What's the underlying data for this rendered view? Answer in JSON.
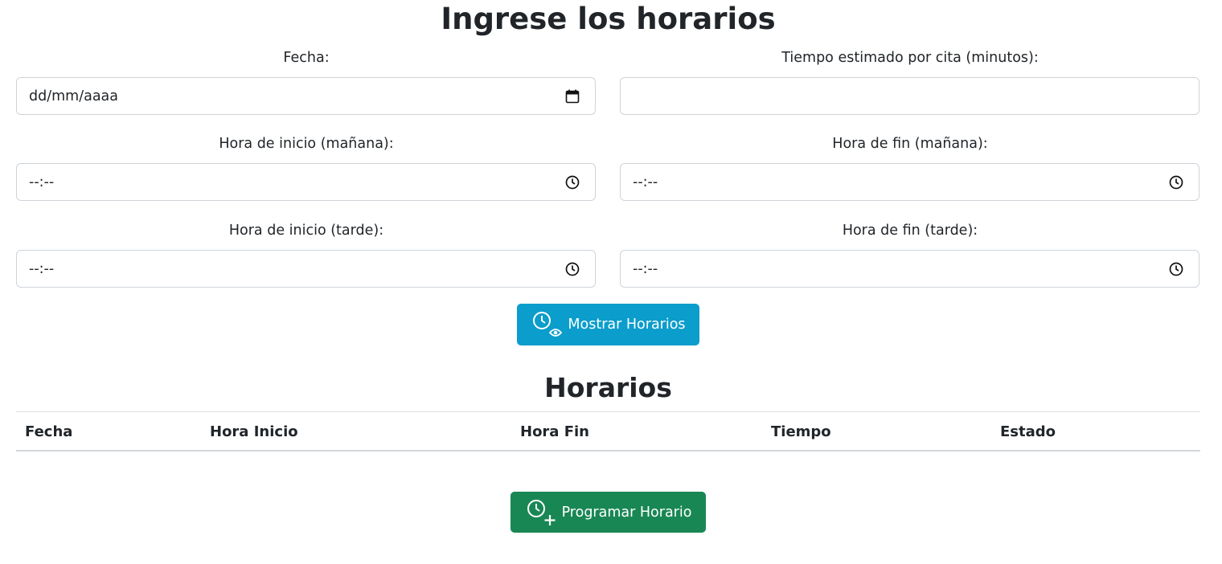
{
  "title": "Ingrese los horarios",
  "form": {
    "fecha": {
      "label": "Fecha:",
      "placeholder": "dd/mm/aaaa",
      "icon": "calendar-icon"
    },
    "tiempo": {
      "label": "Tiempo estimado por cita (minutos):",
      "value": ""
    },
    "inicio_manana": {
      "label": "Hora de inicio (mañana):",
      "placeholder": "--:--",
      "icon": "clock-icon"
    },
    "fin_manana": {
      "label": "Hora de fin (mañana):",
      "placeholder": "--:--",
      "icon": "clock-icon"
    },
    "inicio_tarde": {
      "label": "Hora de inicio (tarde):",
      "placeholder": "--:--",
      "icon": "clock-icon"
    },
    "fin_tarde": {
      "label": "Hora de fin (tarde):",
      "placeholder": "--:--",
      "icon": "clock-icon"
    }
  },
  "buttons": {
    "mostrar": {
      "label": "Mostrar Horarios",
      "icon": "clock-eye-icon",
      "color": "#0b9dcb"
    },
    "programar": {
      "label": "Programar Horario",
      "icon": "clock-plus-icon",
      "color": "#198754"
    }
  },
  "table": {
    "title": "Horarios",
    "headers": [
      "Fecha",
      "Hora Inicio",
      "Hora Fin",
      "Tiempo",
      "Estado"
    ],
    "rows": []
  }
}
